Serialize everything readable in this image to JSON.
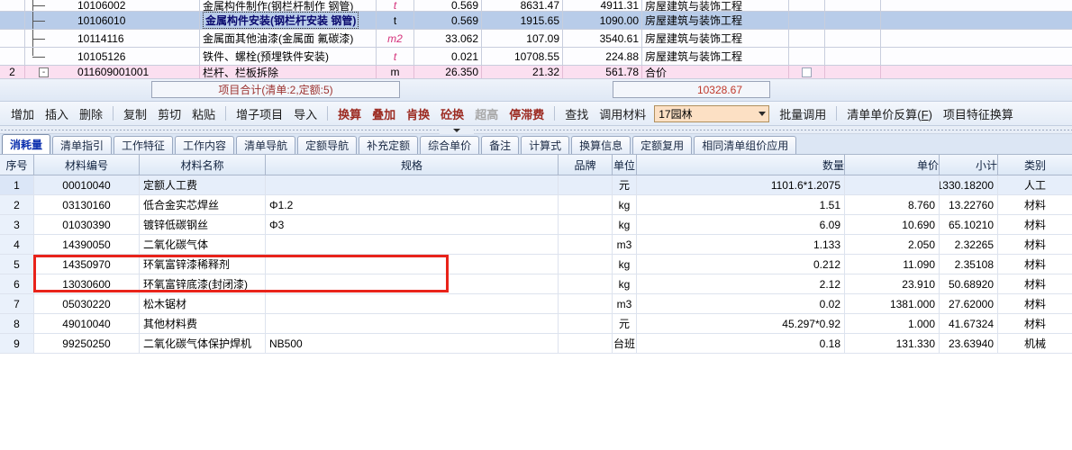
{
  "top_grid": {
    "rows": [
      {
        "idx": "",
        "tree": "branch",
        "code": "10106002",
        "name": "金属构件制作(钢栏杆制作 钢管)",
        "unit": "t",
        "unit_style": "italic-pink",
        "qty": "0.569",
        "price": "8631.47",
        "total": "4911.31",
        "profession": "房屋建筑与装饰工程",
        "checkbox": false,
        "style": "white",
        "clip": "top"
      },
      {
        "idx": "",
        "tree": "branch",
        "code": "10106010",
        "name": "金属构件安装(钢栏杆安装 钢管)",
        "unit": "t",
        "unit_style": "normal",
        "qty": "0.569",
        "price": "1915.65",
        "total": "1090.00",
        "profession": "房屋建筑与装饰工程",
        "checkbox": false,
        "style": "selected",
        "name_selected": true
      },
      {
        "idx": "",
        "tree": "branch",
        "code": "10114116",
        "name": "金属面其他油漆(金属面 氟碳漆)",
        "unit": "m2",
        "unit_style": "italic-pink",
        "qty": "33.062",
        "price": "107.09",
        "total": "3540.61",
        "profession": "房屋建筑与装饰工程",
        "checkbox": false,
        "style": "white"
      },
      {
        "idx": "",
        "tree": "last",
        "code": "10105126",
        "name": "铁件、螺栓(预埋铁件安装)",
        "unit": "t",
        "unit_style": "italic-pink",
        "qty": "0.021",
        "price": "10708.55",
        "total": "224.88",
        "profession": "房屋建筑与装饰工程",
        "checkbox": false,
        "style": "white"
      },
      {
        "idx": "2",
        "tree": "expand",
        "code": "011609001001",
        "name": "栏杆、栏板拆除",
        "unit": "m",
        "unit_style": "normal",
        "qty": "26.350",
        "price": "21.32",
        "total": "561.78",
        "profession": "合价",
        "checkbox": true,
        "style": "pink",
        "clip": "bottom"
      }
    ]
  },
  "total_bar": {
    "label": "项目合计(清单:2,定额:5)",
    "value": "10328.67"
  },
  "toolbar": {
    "groups": [
      {
        "items": [
          {
            "label": "增加",
            "style": "black",
            "disabled": false
          },
          {
            "label": "插入",
            "style": "black",
            "disabled": false
          },
          {
            "label": "删除",
            "style": "black",
            "disabled": false
          }
        ]
      },
      {
        "items": [
          {
            "label": "复制",
            "style": "black",
            "disabled": false
          },
          {
            "label": "剪切",
            "style": "black",
            "disabled": false
          },
          {
            "label": "粘贴",
            "style": "black",
            "disabled": false
          }
        ]
      },
      {
        "items": [
          {
            "label": "增子项目",
            "style": "black",
            "disabled": false
          },
          {
            "label": "导入",
            "style": "black",
            "disabled": false
          }
        ]
      },
      {
        "items": [
          {
            "label": "换算",
            "style": "red",
            "disabled": false
          },
          {
            "label": "叠加",
            "style": "red",
            "disabled": false
          },
          {
            "label": "肯换",
            "style": "red",
            "disabled": false
          },
          {
            "label": "砼换",
            "style": "red",
            "disabled": false
          },
          {
            "label": "超高",
            "style": "red",
            "disabled": true
          },
          {
            "label": "停滞费",
            "style": "red",
            "disabled": false
          }
        ]
      },
      {
        "items": [
          {
            "label": "查找",
            "style": "black",
            "disabled": false
          },
          {
            "label": "调用材料",
            "style": "black",
            "disabled": false
          }
        ]
      }
    ],
    "select_value": "17园林",
    "after_select": [
      {
        "label": "批量调用",
        "style": "black",
        "disabled": false
      }
    ],
    "last_group": [
      {
        "label": "清单单价反算(F)",
        "style": "black",
        "disabled": false,
        "underline_char": "F"
      },
      {
        "label": "项目特征换算",
        "style": "black",
        "disabled": false
      }
    ]
  },
  "tabs": [
    {
      "label": "消耗量",
      "active": true
    },
    {
      "label": "清单指引",
      "active": false
    },
    {
      "label": "工作特征",
      "active": false
    },
    {
      "label": "工作内容",
      "active": false
    },
    {
      "label": "清单导航",
      "active": false
    },
    {
      "label": "定额导航",
      "active": false
    },
    {
      "label": "补充定额",
      "active": false
    },
    {
      "label": "综合单价",
      "active": false
    },
    {
      "label": "备注",
      "active": false
    },
    {
      "label": "计算式",
      "active": false
    },
    {
      "label": "换算信息",
      "active": false
    },
    {
      "label": "定额复用",
      "active": false
    },
    {
      "label": "相同清单组价应用",
      "active": false
    }
  ],
  "main_table": {
    "headers": [
      "序号",
      "材料编号",
      "材料名称",
      "规格",
      "品牌",
      "单位",
      "数量",
      "单价",
      "小计",
      "类别"
    ],
    "rows": [
      {
        "idx": "1",
        "code": "00010040",
        "name": "定额人工费",
        "spec": "",
        "brand": "",
        "unit": "元",
        "qty": "1101.6*1.2075",
        "uprice": "",
        "subtotal": "1330.18200",
        "cat": "人工"
      },
      {
        "idx": "2",
        "code": "03130160",
        "name": "低合金实芯焊丝",
        "spec": "Φ1.2",
        "brand": "",
        "unit": "kg",
        "qty": "1.51",
        "uprice": "8.760",
        "subtotal": "13.22760",
        "cat": "材料"
      },
      {
        "idx": "3",
        "code": "01030390",
        "name": "镀锌低碳钢丝",
        "spec": "Φ3",
        "brand": "",
        "unit": "kg",
        "qty": "6.09",
        "uprice": "10.690",
        "subtotal": "65.10210",
        "cat": "材料"
      },
      {
        "idx": "4",
        "code": "14390050",
        "name": "二氧化碳气体",
        "spec": "",
        "brand": "",
        "unit": "m3",
        "qty": "1.133",
        "uprice": "2.050",
        "subtotal": "2.32265",
        "cat": "材料"
      },
      {
        "idx": "5",
        "code": "14350970",
        "name": "环氧富锌漆稀释剂",
        "spec": "",
        "brand": "",
        "unit": "kg",
        "qty": "0.212",
        "uprice": "11.090",
        "subtotal": "2.35108",
        "cat": "材料"
      },
      {
        "idx": "6",
        "code": "13030600",
        "name": "环氧富锌底漆(封闭漆)",
        "spec": "",
        "brand": "",
        "unit": "kg",
        "qty": "2.12",
        "uprice": "23.910",
        "subtotal": "50.68920",
        "cat": "材料"
      },
      {
        "idx": "7",
        "code": "05030220",
        "name": "松木锯材",
        "spec": "",
        "brand": "",
        "unit": "m3",
        "qty": "0.02",
        "uprice": "1381.000",
        "subtotal": "27.62000",
        "cat": "材料"
      },
      {
        "idx": "8",
        "code": "49010040",
        "name": "其他材料费",
        "spec": "",
        "brand": "",
        "unit": "元",
        "qty": "45.297*0.92",
        "uprice": "1.000",
        "subtotal": "41.67324",
        "cat": "材料"
      },
      {
        "idx": "9",
        "code": "99250250",
        "name": "二氧化碳气体保护焊机",
        "spec": "NB500",
        "brand": "",
        "unit": "台班",
        "qty": "0.18",
        "uprice": "131.330",
        "subtotal": "23.63940",
        "cat": "机械"
      }
    ]
  },
  "annotation": {
    "highlight_color": "#e8231a",
    "highlighted_rows": [
      "5",
      "6"
    ]
  }
}
